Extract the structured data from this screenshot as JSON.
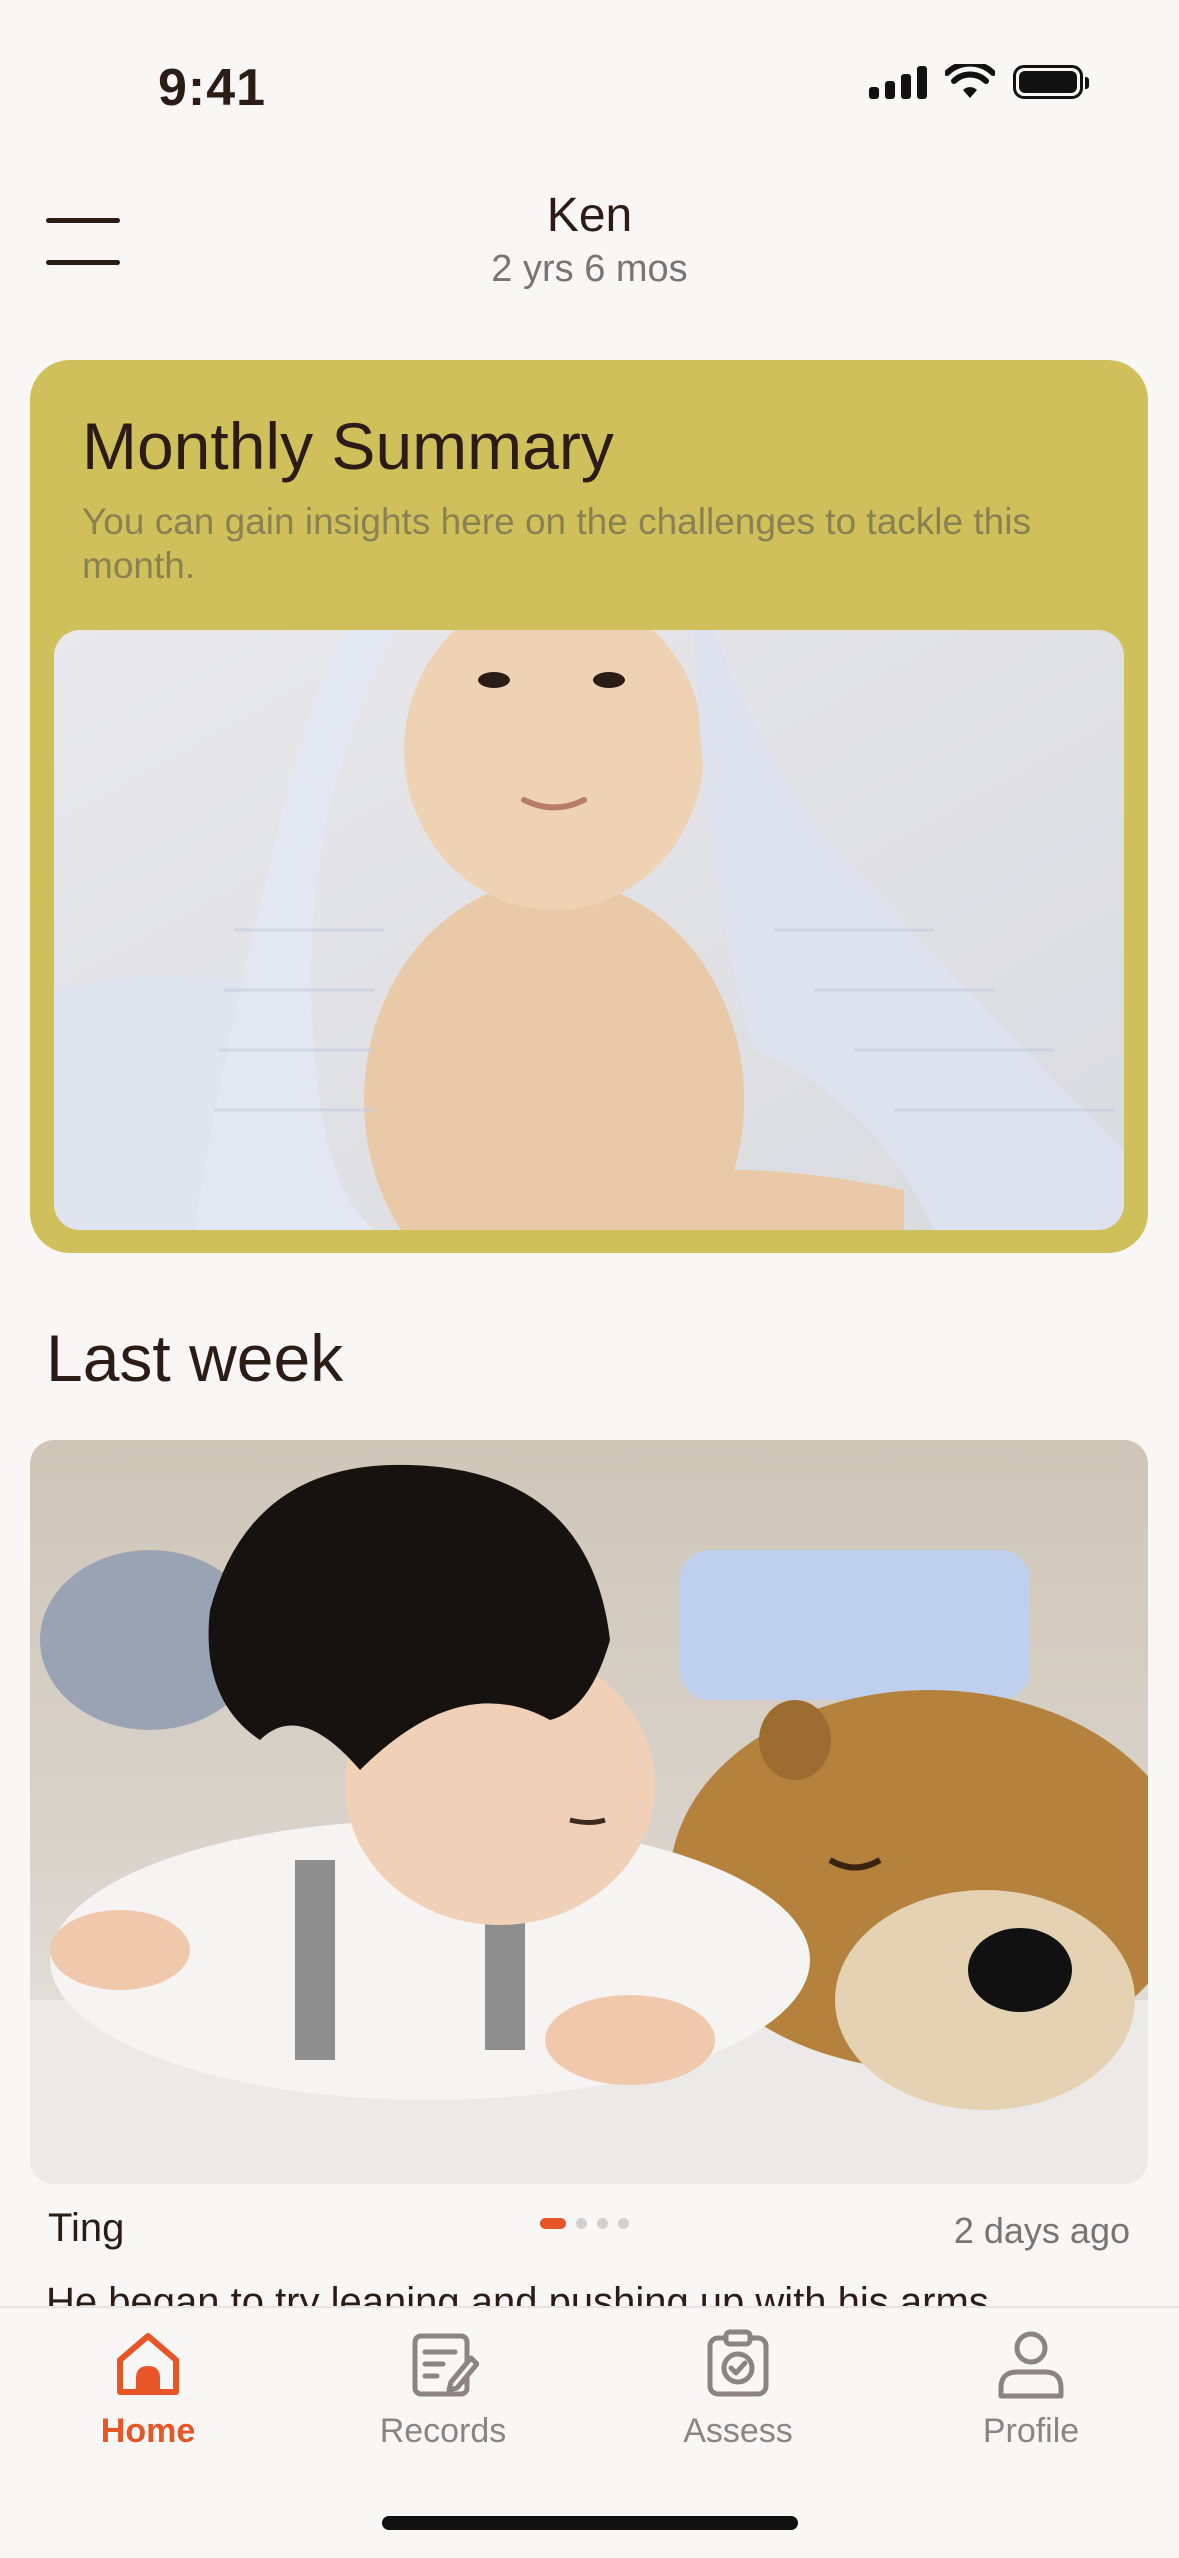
{
  "status_bar": {
    "time": "9:41"
  },
  "header": {
    "child_name": "Ken",
    "child_age": "2 yrs 6 mos"
  },
  "summary": {
    "title": "Monthly Summary",
    "description": "You can gain insights here on the challenges to tackle this month."
  },
  "last_week": {
    "section_title": "Last week",
    "post": {
      "author": "Ting",
      "time_ago": "2 days ago",
      "text_peek": "He began to try leaning and pushing up with his arms",
      "carousel_pages": 4,
      "carousel_active": 1
    }
  },
  "tabbar": {
    "items": [
      {
        "label": "Home",
        "icon": "home-icon",
        "active": true
      },
      {
        "label": "Records",
        "icon": "records-icon",
        "active": false
      },
      {
        "label": "Assess",
        "icon": "assess-icon",
        "active": false
      },
      {
        "label": "Profile",
        "icon": "profile-icon",
        "active": false
      }
    ]
  },
  "colors": {
    "accent": "#e85526",
    "summary_card": "#cfc05c",
    "background": "#f8f7f5",
    "text_primary": "#2b1d16",
    "text_secondary": "#7b7471"
  }
}
